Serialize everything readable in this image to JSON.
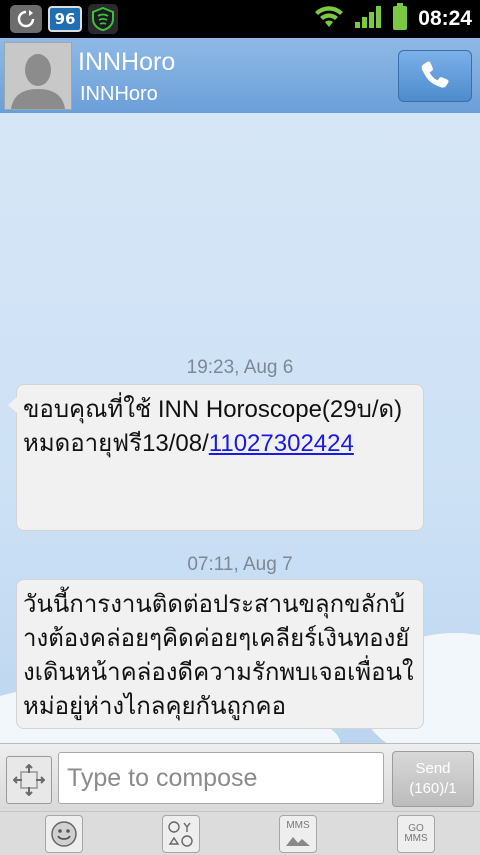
{
  "status_bar": {
    "time": "08:24",
    "notification_badge": "96",
    "icons": [
      "refresh-icon",
      "badge-96",
      "shield-icon",
      "wifi-icon",
      "signal-icon",
      "battery-icon"
    ]
  },
  "header": {
    "contact_name": "INNHoro",
    "contact_number": "INNHoro"
  },
  "messages": [
    {
      "timestamp": "19:23, Aug 6",
      "text": "ขอบคุณที่ใช้ INN Horoscope(29บ/ด)หมดอายุฟรี13/08/",
      "link": "11027302424"
    },
    {
      "timestamp": "07:11, Aug 7",
      "text": "วันนี้การงานติดต่อประสานขลุกขลักบ้างต้องคล่อยๆคิดค่อยๆเคลียร์เงินทองยังเดินหน้าคล่องดีความรักพบเจอเพื่อนใหม่อยู่ห่างไกลคุยกันถูกคอ"
    }
  ],
  "compose": {
    "placeholder": "Type to compose",
    "send_label": "Send",
    "send_counter": "(160)/1"
  },
  "toolbar": {
    "mms_label": "MMS",
    "go_mms_label": "GO\nMMS"
  },
  "colors": {
    "link": "#1a1ae6",
    "header_bg": "#7aa9dd",
    "bubble_bg": "#f1f1f1"
  }
}
